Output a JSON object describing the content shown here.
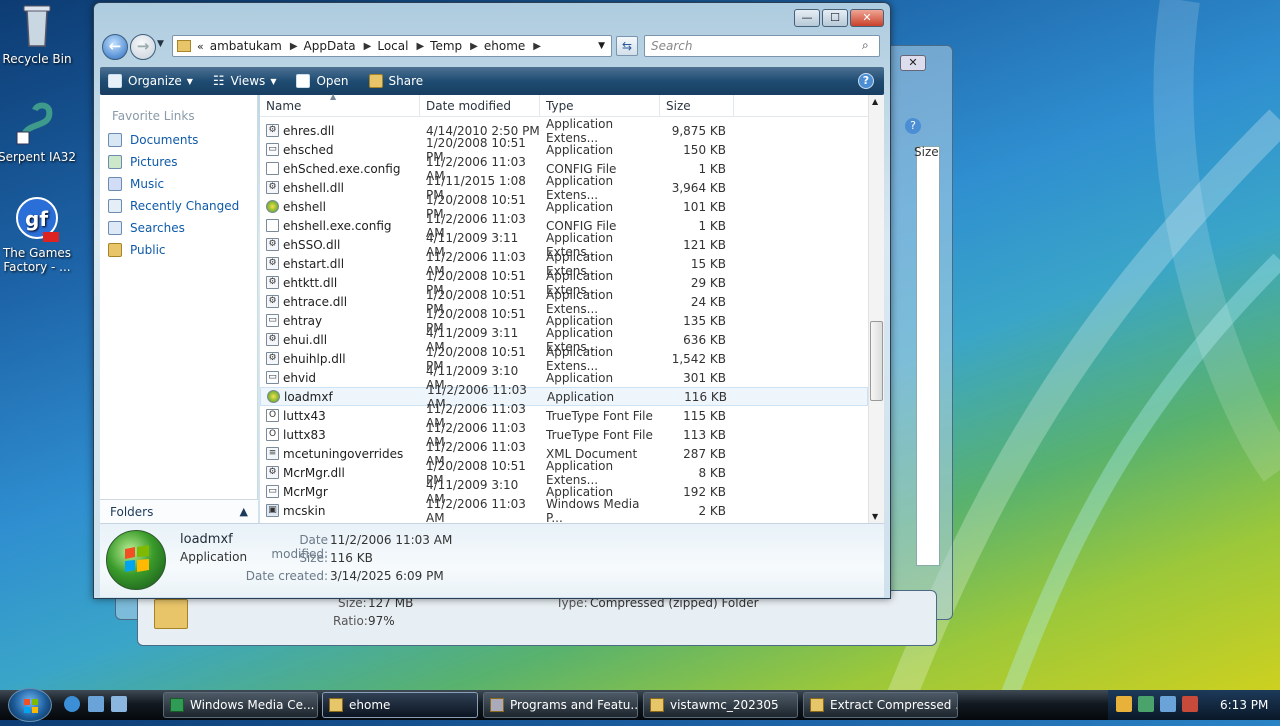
{
  "desktop": {
    "icons": [
      {
        "label": "Recycle Bin"
      },
      {
        "label": "Serpent IA32"
      },
      {
        "label_line1": "The Games",
        "label_line2": "Factory - ..."
      }
    ]
  },
  "back_window": {
    "size_label": "Size:",
    "size_value": "127 MB",
    "ratio_label": "Ratio:",
    "ratio_value": "97%",
    "type_label": "Type:",
    "type_value": "Compressed (zipped) Folder",
    "col_size_partial": "Size"
  },
  "window": {
    "controls": {
      "minimize": "—",
      "maximize": "☐",
      "close": "✕"
    },
    "breadcrumb": [
      "ambatukam",
      "AppData",
      "Local",
      "Temp",
      "ehome"
    ],
    "search_placeholder": "Search",
    "toolbar": {
      "organize": "Organize",
      "views": "Views",
      "open": "Open",
      "share": "Share",
      "help": "?"
    },
    "nav": {
      "title": "Favorite Links",
      "items": [
        "Documents",
        "Pictures",
        "Music",
        "Recently Changed",
        "Searches",
        "Public"
      ],
      "folders": "Folders"
    },
    "columns": {
      "name": "Name",
      "date": "Date modified",
      "type": "Type",
      "size": "Size"
    },
    "files": [
      {
        "name": "ehres.dll",
        "date": "4/14/2010 2:50 PM",
        "type": "Application Extens...",
        "size": "9,875 KB",
        "icon": "dll"
      },
      {
        "name": "ehsched",
        "date": "1/20/2008 10:51 PM",
        "type": "Application",
        "size": "150 KB",
        "icon": "app"
      },
      {
        "name": "ehSched.exe.config",
        "date": "11/2/2006 11:03 AM",
        "type": "CONFIG File",
        "size": "1 KB",
        "icon": "blank"
      },
      {
        "name": "ehshell.dll",
        "date": "11/11/2015 1:08 PM",
        "type": "Application Extens...",
        "size": "3,964 KB",
        "icon": "dll"
      },
      {
        "name": "ehshell",
        "date": "1/20/2008 10:51 PM",
        "type": "Application",
        "size": "101 KB",
        "icon": "mce"
      },
      {
        "name": "ehshell.exe.config",
        "date": "11/2/2006 11:03 AM",
        "type": "CONFIG File",
        "size": "1 KB",
        "icon": "blank"
      },
      {
        "name": "ehSSO.dll",
        "date": "4/11/2009 3:11 AM",
        "type": "Application Extens...",
        "size": "121 KB",
        "icon": "dll"
      },
      {
        "name": "ehstart.dll",
        "date": "11/2/2006 11:03 AM",
        "type": "Application Extens...",
        "size": "15 KB",
        "icon": "dll"
      },
      {
        "name": "ehtktt.dll",
        "date": "1/20/2008 10:51 PM",
        "type": "Application Extens...",
        "size": "29 KB",
        "icon": "dll"
      },
      {
        "name": "ehtrace.dll",
        "date": "1/20/2008 10:51 PM",
        "type": "Application Extens...",
        "size": "24 KB",
        "icon": "dll"
      },
      {
        "name": "ehtray",
        "date": "1/20/2008 10:51 PM",
        "type": "Application",
        "size": "135 KB",
        "icon": "app"
      },
      {
        "name": "ehui.dll",
        "date": "4/11/2009 3:11 AM",
        "type": "Application Extens...",
        "size": "636 KB",
        "icon": "dll"
      },
      {
        "name": "ehuihlp.dll",
        "date": "1/20/2008 10:51 PM",
        "type": "Application Extens...",
        "size": "1,542 KB",
        "icon": "dll"
      },
      {
        "name": "ehvid",
        "date": "4/11/2009 3:10 AM",
        "type": "Application",
        "size": "301 KB",
        "icon": "app"
      },
      {
        "name": "loadmxf",
        "date": "11/2/2006 11:03 AM",
        "type": "Application",
        "size": "116 KB",
        "icon": "mce",
        "selected": true
      },
      {
        "name": "luttx43",
        "date": "11/2/2006 11:03 AM",
        "type": "TrueType Font File",
        "size": "115 KB",
        "icon": "font"
      },
      {
        "name": "luttx83",
        "date": "11/2/2006 11:03 AM",
        "type": "TrueType Font File",
        "size": "113 KB",
        "icon": "font"
      },
      {
        "name": "mcetuningoverrides",
        "date": "11/2/2006 11:03 AM",
        "type": "XML Document",
        "size": "287 KB",
        "icon": "xml"
      },
      {
        "name": "McrMgr.dll",
        "date": "1/20/2008 10:51 PM",
        "type": "Application Extens...",
        "size": "8 KB",
        "icon": "dll"
      },
      {
        "name": "McrMgr",
        "date": "4/11/2009 3:10 AM",
        "type": "Application",
        "size": "192 KB",
        "icon": "app"
      },
      {
        "name": "mcskin",
        "date": "11/2/2006 11:03 AM",
        "type": "Windows Media P...",
        "size": "2 KB",
        "icon": "wmp"
      }
    ],
    "details": {
      "name": "loadmxf",
      "kind": "Application",
      "date_modified_label": "Date modified:",
      "date_modified": "11/2/2006 11:03 AM",
      "size_label": "Size:",
      "size": "116 KB",
      "date_created_label": "Date created:",
      "date_created": "3/14/2025 6:09 PM"
    }
  },
  "taskbar": {
    "tasks": [
      "Windows Media Ce...",
      "ehome",
      "Programs and Featu...",
      "vistawmc_202305",
      "Extract Compressed ..."
    ],
    "clock": "6:13 PM"
  }
}
